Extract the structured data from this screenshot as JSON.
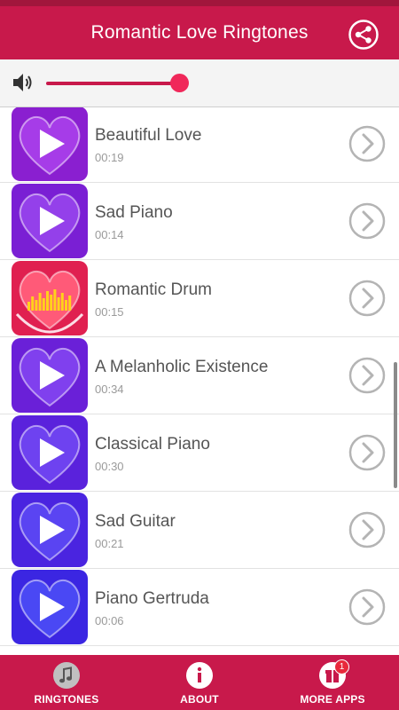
{
  "app": {
    "title": "Romantic Love Ringtones",
    "accent": "#c8194b"
  },
  "volume": {
    "level": 0.68
  },
  "ringtones": [
    {
      "title": "Beautiful Love",
      "duration": "00:19",
      "icon": "heart-play-icon"
    },
    {
      "title": "Sad Piano",
      "duration": "00:14",
      "icon": "heart-play-icon"
    },
    {
      "title": "Romantic Drum",
      "duration": "00:15",
      "icon": "heart-equalizer-icon"
    },
    {
      "title": "A Melanholic Existence",
      "duration": "00:34",
      "icon": "heart-play-icon"
    },
    {
      "title": "Classical Piano",
      "duration": "00:30",
      "icon": "heart-play-icon"
    },
    {
      "title": "Sad Guitar",
      "duration": "00:21",
      "icon": "heart-play-icon"
    },
    {
      "title": "Piano Gertruda",
      "duration": "00:06",
      "icon": "heart-play-icon"
    }
  ],
  "nav": {
    "ringtones": "RINGTONES",
    "about": "ABOUT",
    "more_apps": "MORE APPS",
    "more_apps_badge": "1"
  }
}
